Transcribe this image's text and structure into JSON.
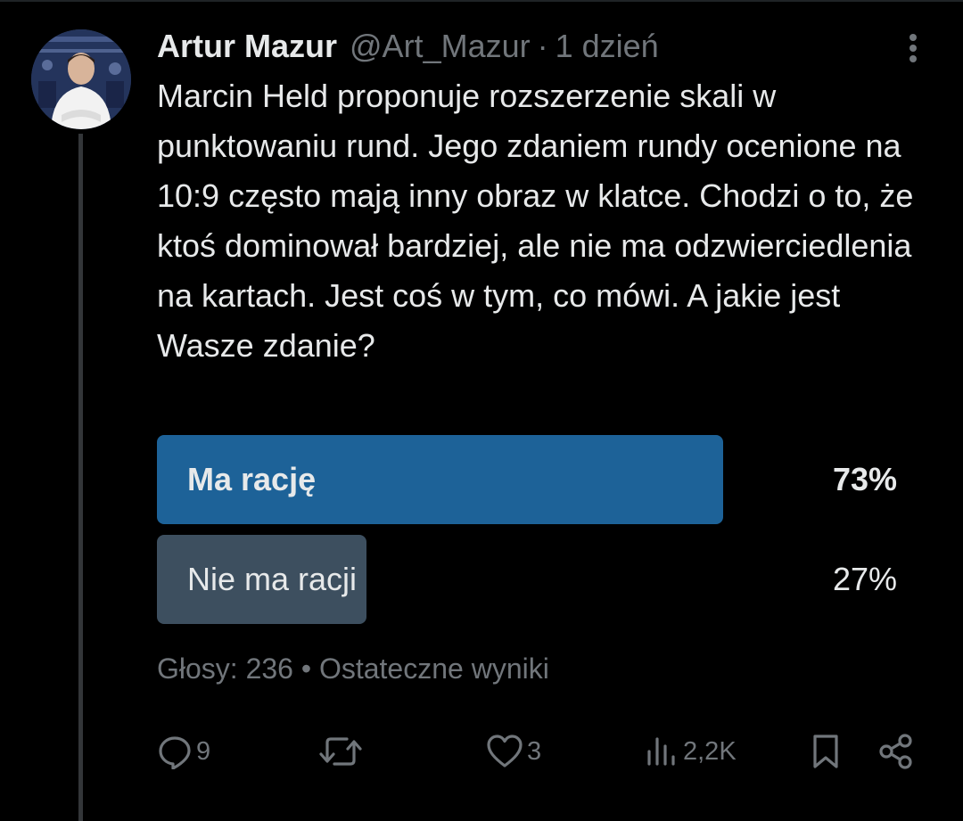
{
  "tweet": {
    "author_name": "Artur Mazur",
    "handle": "@Art_Mazur",
    "separator": "·",
    "time": "1 dzień",
    "text": "Marcin Held proponuje rozszerzenie skali w punktowaniu rund. Jego zdaniem rundy ocenione na 10:9 często mają inny obraz w klatce. Chodzi o to, że ktoś dominował bardziej, ale nie ma odzwierciedlenia na kartach. Jest coś w tym, co mówi. A jakie jest Wasze zdanie?"
  },
  "poll": {
    "options": [
      {
        "label": "Ma rację",
        "percent_label": "73%",
        "percent": 73,
        "color": "#1d6298"
      },
      {
        "label": "Nie ma racji",
        "percent_label": "27%",
        "percent": 27,
        "color": "#3d4f5f"
      }
    ],
    "votes": "Głosy: 236",
    "separator": "•",
    "status": "Ostateczne wyniki"
  },
  "actions": {
    "replies": "9",
    "likes": "3",
    "views": "2,2K"
  },
  "icons": {
    "more": "more-vertical-icon",
    "reply": "reply-icon",
    "retweet": "retweet-icon",
    "like": "heart-icon",
    "views": "views-bar-chart-icon",
    "bookmark": "bookmark-icon",
    "share": "share-icon"
  },
  "colors": {
    "background": "#000000",
    "text": "#e7e9ea",
    "muted": "#71767b",
    "winning_bar": "#1d6298",
    "losing_bar": "#3d4f5f"
  }
}
